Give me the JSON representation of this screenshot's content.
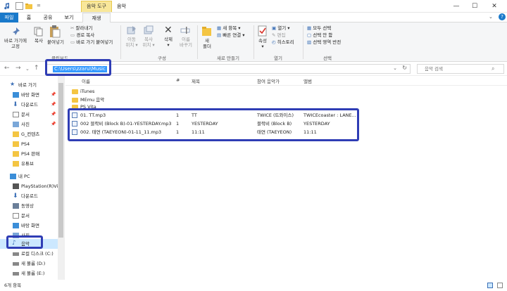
{
  "titlebar": {
    "context_tab": "음악 도구",
    "title": "음악",
    "min": "—",
    "max": "☐",
    "close": "✕"
  },
  "tabs": {
    "file": "파일",
    "home": "홈",
    "share": "공유",
    "view": "보기",
    "play": "재생"
  },
  "ribbon": {
    "pin": "바로 가기에\n고정",
    "copy": "복사",
    "paste": "붙여넣기",
    "cut": "잘라내기",
    "copy_path": "경로 복사",
    "paste_shortcut": "바로 가기 붙여넣기",
    "group_clipboard": "클립보드",
    "move_to": "이동\n위치 ▾",
    "copy_to": "복사\n위치 ▾",
    "delete": "삭제\n▾",
    "rename": "이름\n바꾸기",
    "group_organize": "구성",
    "new_folder": "새\n폴더",
    "new_item": "새 항목 ▾",
    "easy_access": "빠른 연결 ▾",
    "group_new": "새로 만들기",
    "properties": "속성\n▾",
    "open": "열기 ▾",
    "edit": "편집",
    "history": "히스토리",
    "group_open": "열기",
    "select_all": "모두 선택",
    "select_none": "선택 안 함",
    "invert_selection": "선택 영역 반전",
    "group_select": "선택"
  },
  "address": {
    "path": "C:\\Users\\zzaru\\Music",
    "search_placeholder": "음악 검색"
  },
  "nav": {
    "quick_access": "바로 가기",
    "desktop": "바탕 화면",
    "downloads": "다운로드",
    "documents": "문서",
    "pictures": "사진",
    "g_contents": "G_컨텐츠",
    "ps4": "PS4",
    "ps4_sale": "PS4 판매",
    "youtube": "유튜브",
    "this_pc": "내 PC",
    "playstation": "PlayStation(R)Vi",
    "pc_downloads": "다운로드",
    "videos": "동영상",
    "pc_documents": "문서",
    "pc_desktop": "바탕 화면",
    "pc_pictures": "사진",
    "music": "음악",
    "local_disk": "로컬 디스크 (C:)",
    "volume_d": "새 볼륨 (D:)",
    "volume_e": "새 볼륨 (E:)"
  },
  "columns": {
    "name": "이름",
    "number": "#",
    "title": "제목",
    "artist": "참여 음악가",
    "album": "앨범"
  },
  "folders": [
    "iTunes",
    "MEmu 음악",
    "PS Vita"
  ],
  "files": [
    {
      "name": "01. TT.mp3",
      "number": "1",
      "title": "TT",
      "artist": "TWICE (트와이스)",
      "album": "TWICEcoaster : LANE..."
    },
    {
      "name": "002 블락비 (Block B)-01-YESTERDAY.mp3",
      "number": "1",
      "title": "YESTERDAY",
      "artist": "블락비 (Block B)",
      "album": "YESTERDAY"
    },
    {
      "name": "002. 태연 (TAEYEON)-01-11_11.mp3",
      "number": "1",
      "title": "11:11",
      "artist": "태연 (TAEYEON)",
      "album": "11:11"
    }
  ],
  "status": {
    "count": "6개 항목"
  },
  "colors": {
    "highlight": "#2f3db5",
    "file_tab": "#1979ca",
    "context_tab": "#f8e79a",
    "address_selection": "#3399ff"
  }
}
